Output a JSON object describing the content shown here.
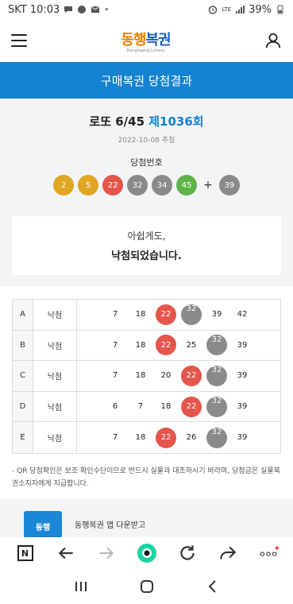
{
  "status": {
    "carrier_time": "SKT 10:03",
    "battery": "39%",
    "network": "LTE"
  },
  "header": {
    "logo_main_a": "동행",
    "logo_main_b": "복권",
    "logo_sub": "Donghaeng Lottery",
    "menu_icon": "hamburger-icon",
    "user_icon": "user-icon"
  },
  "title": "구매복권 당첨결과",
  "round": {
    "prefix": "로또 6/45 ",
    "number": "제1036회",
    "draw_date": "2022-10-08 추첨",
    "win_label": "당첨번호",
    "win_numbers": [
      {
        "n": "2",
        "color": "#e0a624"
      },
      {
        "n": "5",
        "color": "#e0a624"
      },
      {
        "n": "22",
        "color": "#e4554b"
      },
      {
        "n": "32",
        "color": "#8a8a8a"
      },
      {
        "n": "34",
        "color": "#8a8a8a"
      },
      {
        "n": "45",
        "color": "#5eb447"
      }
    ],
    "plus": "+",
    "bonus": {
      "n": "39",
      "color": "#8a8a8a"
    }
  },
  "result": {
    "line1": "아쉽게도,",
    "line2": "낙첨되었습니다."
  },
  "games": [
    {
      "label": "A",
      "status": "낙첨",
      "nums": [
        {
          "v": "7",
          "m": ""
        },
        {
          "v": "18",
          "m": ""
        },
        {
          "v": "22",
          "m": "red"
        },
        {
          "v": "32",
          "m": "gray"
        },
        {
          "v": "39",
          "m": ""
        },
        {
          "v": "42",
          "m": ""
        }
      ]
    },
    {
      "label": "B",
      "status": "낙첨",
      "nums": [
        {
          "v": "7",
          "m": ""
        },
        {
          "v": "18",
          "m": ""
        },
        {
          "v": "22",
          "m": "red"
        },
        {
          "v": "25",
          "m": ""
        },
        {
          "v": "32",
          "m": "gray"
        },
        {
          "v": "39",
          "m": ""
        }
      ]
    },
    {
      "label": "C",
      "status": "낙첨",
      "nums": [
        {
          "v": "7",
          "m": ""
        },
        {
          "v": "18",
          "m": ""
        },
        {
          "v": "20",
          "m": ""
        },
        {
          "v": "22",
          "m": "red"
        },
        {
          "v": "32",
          "m": "gray"
        },
        {
          "v": "39",
          "m": ""
        }
      ]
    },
    {
      "label": "D",
      "status": "낙첨",
      "nums": [
        {
          "v": "6",
          "m": ""
        },
        {
          "v": "7",
          "m": ""
        },
        {
          "v": "18",
          "m": ""
        },
        {
          "v": "22",
          "m": "red"
        },
        {
          "v": "32",
          "m": "gray"
        },
        {
          "v": "39",
          "m": ""
        }
      ]
    },
    {
      "label": "E",
      "status": "낙첨",
      "nums": [
        {
          "v": "7",
          "m": ""
        },
        {
          "v": "18",
          "m": ""
        },
        {
          "v": "22",
          "m": "red"
        },
        {
          "v": "26",
          "m": ""
        },
        {
          "v": "32",
          "m": "gray"
        },
        {
          "v": "39",
          "m": ""
        }
      ]
    }
  ],
  "notice": "- QR 당첨확인은 보조 확인수단이므로 반드시 실물과 대조하시기 바라며, 당첨금은 실물복권소지자에게 지급합니다.",
  "app_banner": {
    "logo": "동행",
    "title": "동행복권 앱 다운받고"
  },
  "browser": {
    "n_label": "N",
    "icons": [
      "back-arrow-icon",
      "forward-arrow-icon",
      "home-circle-icon",
      "refresh-icon",
      "share-icon",
      "more-icon"
    ]
  },
  "nav": {
    "icons": [
      "recent-apps-icon",
      "home-icon",
      "back-icon"
    ]
  }
}
